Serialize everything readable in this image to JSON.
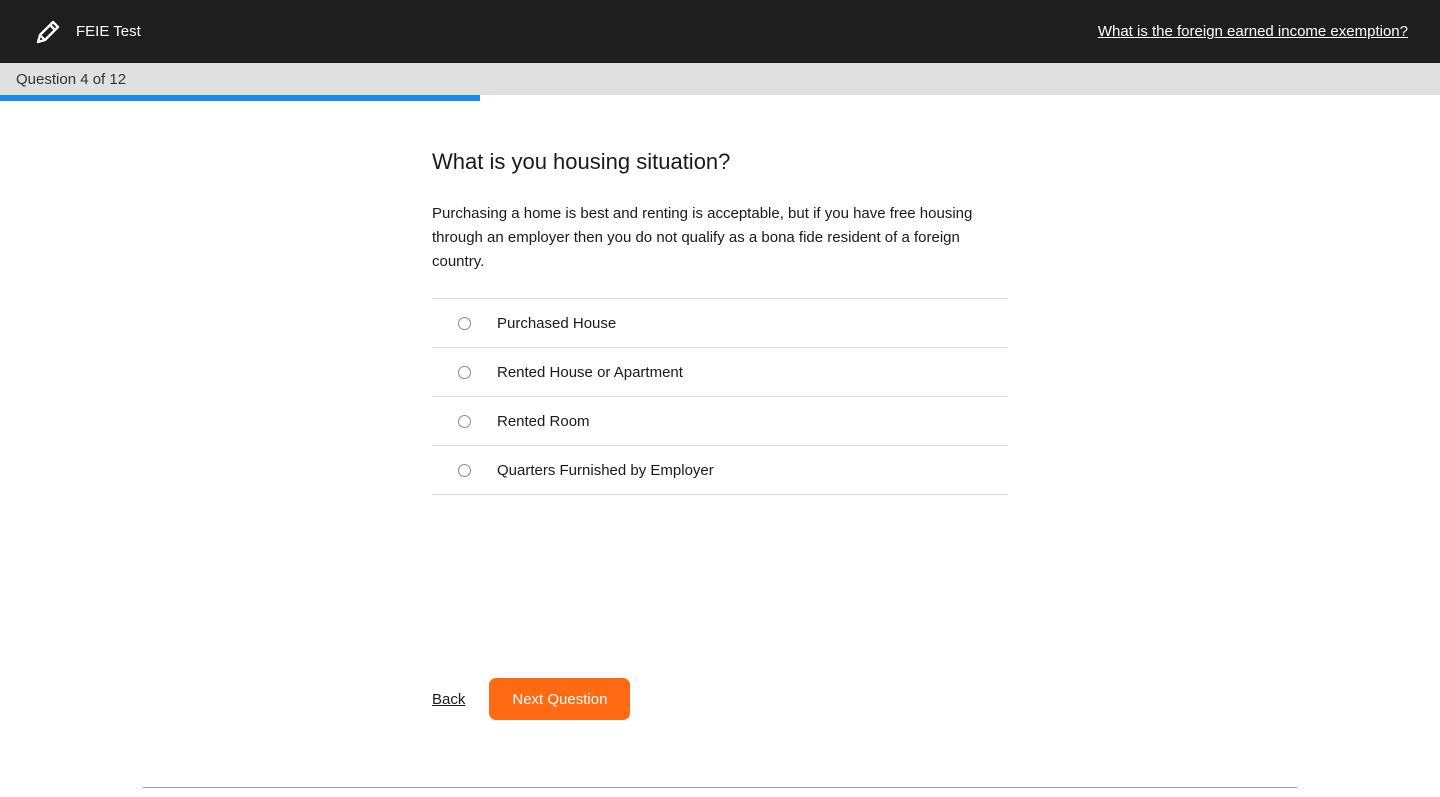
{
  "header": {
    "app_title": "FEIE Test",
    "icon": "pencil-icon",
    "help_link": "What is the foreign earned income exemption?"
  },
  "progress": {
    "label": "Question 4 of 12",
    "current": 4,
    "total": 12,
    "fraction": 0.3333,
    "color": "#1a8cf0"
  },
  "question": {
    "title": "What is you housing situation?",
    "description": "Purchasing a home is best and renting is acceptable, but if you have free housing through an employer then you do not qualify as a bona fide resident of a foreign country.",
    "options": [
      {
        "label": "Purchased House",
        "selected": false
      },
      {
        "label": "Rented House or Apartment",
        "selected": false
      },
      {
        "label": "Rented Room",
        "selected": false
      },
      {
        "label": "Quarters Furnished by Employer",
        "selected": false
      }
    ]
  },
  "navigation": {
    "back_label": "Back",
    "next_label": "Next Question",
    "accent_color": "#ff6a13"
  }
}
